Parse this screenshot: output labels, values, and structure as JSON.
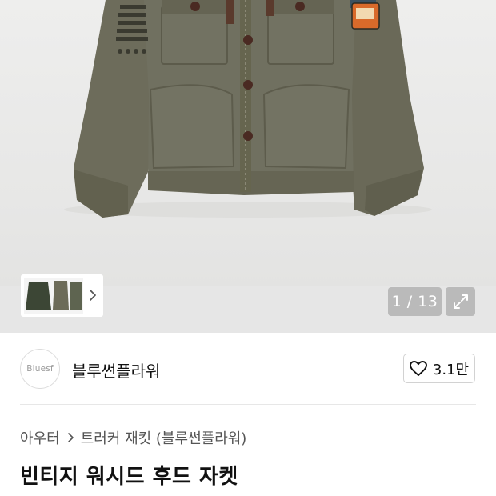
{
  "gallery": {
    "counter": "1 / 13",
    "image_label": "product-photo-vintage-washed-hood-jacket"
  },
  "brand": {
    "logo_text": "Bluesf",
    "name": "블루썬플라워",
    "likes": "3.1만"
  },
  "breadcrumb": {
    "category": "아우터",
    "subcategory": "트러커 재킷 (블루썬플라워)"
  },
  "product": {
    "title": "빈티지 워시드 후드 자켓"
  },
  "icons": {
    "thumbs_arrow": "chevron-right-icon",
    "expand": "expand-icon",
    "like": "heart-outline-icon",
    "breadcrumb_sep": "chevron-right-icon"
  },
  "colors": {
    "jacket_olive": "#6b6b5a",
    "counter_bg": "#9a9a9a",
    "text_dark": "#111111",
    "text_gray": "#555555"
  }
}
